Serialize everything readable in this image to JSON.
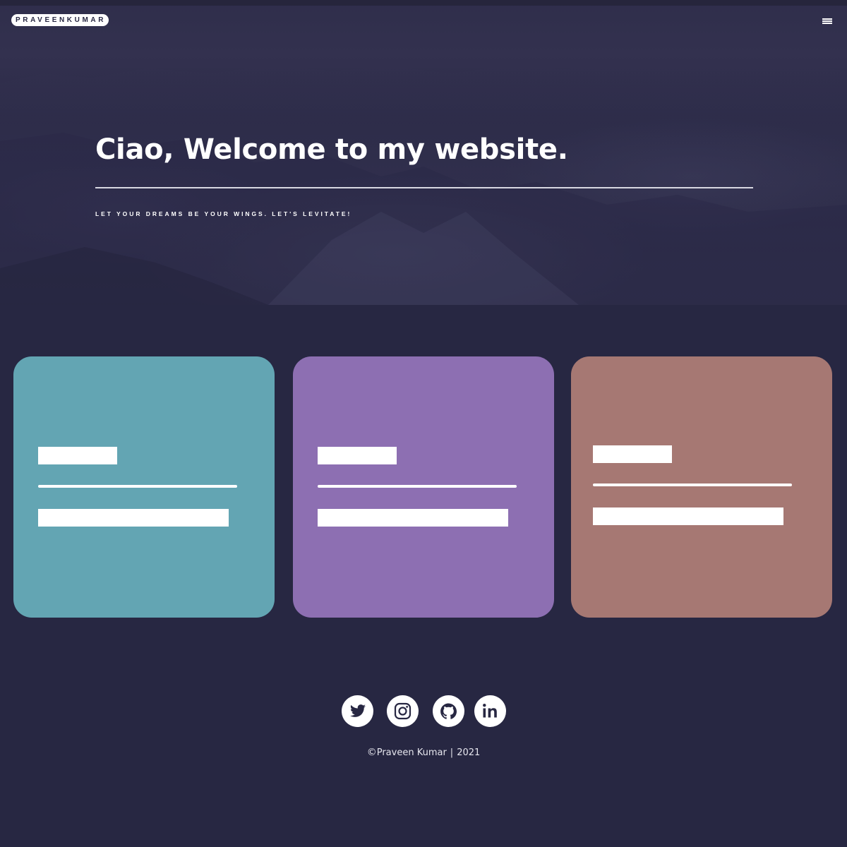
{
  "header": {
    "logo_text": "PRAVEENKUMAR",
    "menu_icon": "hamburger-icon"
  },
  "hero": {
    "title": "Ciao, Welcome to my website.",
    "subtitle": "LET YOUR DREAMS BE YOUR WINGS. LET'S LEVITATE!"
  },
  "cards": [
    {
      "color": "#63a5b3"
    },
    {
      "color": "#8d6fb2"
    },
    {
      "color": "#a67873"
    }
  ],
  "social": [
    {
      "icon": "twitter-icon"
    },
    {
      "icon": "instagram-icon"
    },
    {
      "icon": "github-icon"
    },
    {
      "icon": "linkedin-icon"
    }
  ],
  "footer": {
    "copyright_symbol": "©",
    "name": "Praveen Kumar",
    "separator": "|",
    "year": "2021"
  },
  "colors": {
    "background": "#272742",
    "hero_dark": "#2b2a47",
    "accent_white": "#ffffff"
  }
}
